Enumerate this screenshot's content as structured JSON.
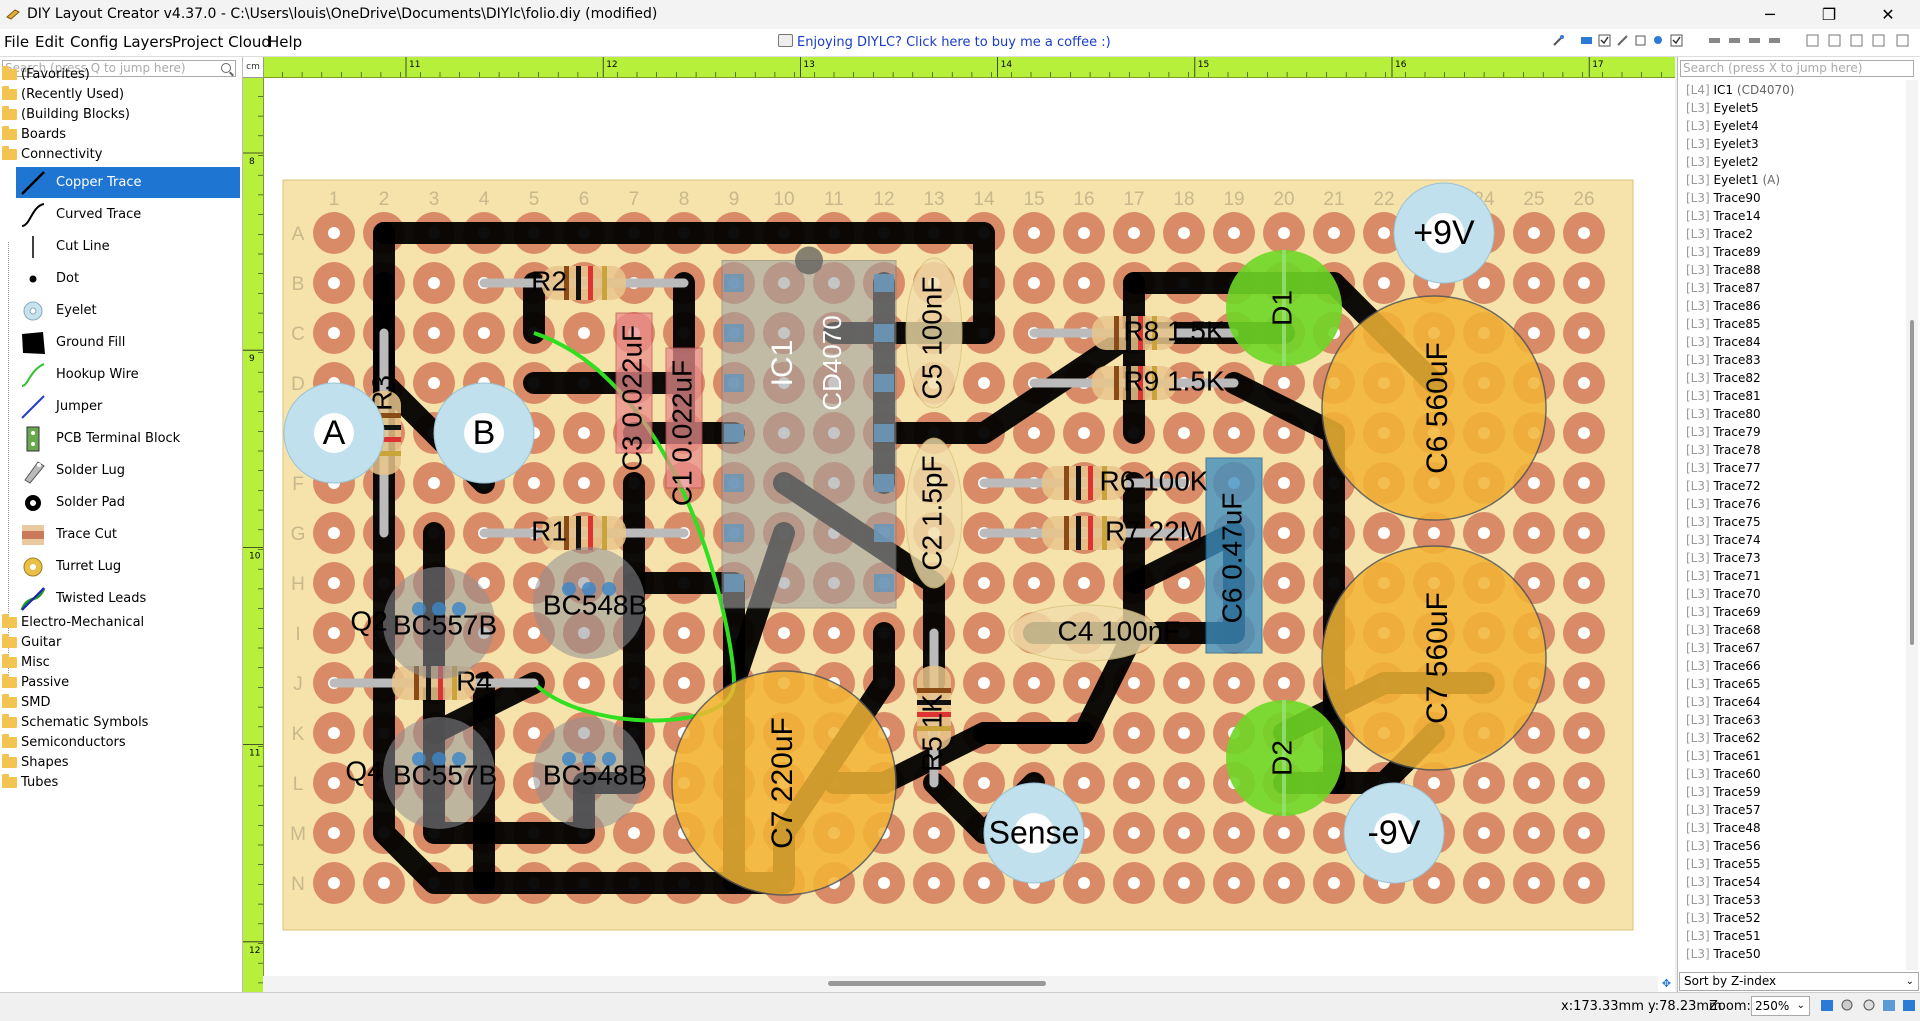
{
  "window": {
    "title": "DIY Layout Creator v4.37.0 - C:\\Users\\louis\\OneDrive\\Documents\\DIYlc\\folio.diy  (modified)",
    "controls": {
      "minimize": "─",
      "restore": "❐",
      "close": "✕"
    }
  },
  "menu": {
    "items": [
      "File",
      "Edit",
      "Config",
      "Layers",
      "Project Cloud",
      "Help"
    ],
    "coffee_link": "Enjoying DIYLC? Click here to buy me a coffee :)"
  },
  "left_panel": {
    "search_placeholder": "Search (press Q to jump here)",
    "folders_top": [
      "(Favorites)",
      "(Recently Used)",
      "(Building Blocks)",
      "Boards",
      "Connectivity"
    ],
    "connectivity_items": [
      {
        "label": "Copper Trace",
        "icon": "copper-trace-icon",
        "selected": true
      },
      {
        "label": "Curved Trace",
        "icon": "curved-trace-icon"
      },
      {
        "label": "Cut Line",
        "icon": "cut-line-icon"
      },
      {
        "label": "Dot",
        "icon": "dot-icon"
      },
      {
        "label": "Eyelet",
        "icon": "eyelet-icon"
      },
      {
        "label": "Ground Fill",
        "icon": "ground-fill-icon"
      },
      {
        "label": "Hookup Wire",
        "icon": "hookup-wire-icon"
      },
      {
        "label": "Jumper",
        "icon": "jumper-icon"
      },
      {
        "label": "PCB Terminal Block",
        "icon": "pcb-terminal-block-icon"
      },
      {
        "label": "Solder Lug",
        "icon": "solder-lug-icon"
      },
      {
        "label": "Solder Pad",
        "icon": "solder-pad-icon"
      },
      {
        "label": "Trace Cut",
        "icon": "trace-cut-icon"
      },
      {
        "label": "Turret Lug",
        "icon": "turret-lug-icon"
      },
      {
        "label": "Twisted Leads",
        "icon": "twisted-leads-icon"
      }
    ],
    "folders_bottom": [
      "Electro-Mechanical",
      "Guitar",
      "Misc",
      "Passive",
      "SMD",
      "Schematic Symbols",
      "Semiconductors",
      "Shapes",
      "Tubes"
    ]
  },
  "canvas": {
    "ruler_unit": "cm",
    "ruler_top": [
      "11",
      "12",
      "13",
      "14",
      "15",
      "16",
      "17"
    ],
    "ruler_left": [
      "8",
      "9",
      "10",
      "11",
      "12"
    ],
    "board": {
      "column_labels": [
        "1",
        "2",
        "3",
        "4",
        "5",
        "6",
        "7",
        "8",
        "9",
        "10",
        "11",
        "12",
        "13",
        "14",
        "15",
        "16",
        "17",
        "18",
        "19",
        "20",
        "21",
        "22",
        "23",
        "24",
        "25",
        "26"
      ],
      "row_labels": [
        "A",
        "B",
        "C",
        "D",
        "E",
        "F",
        "G",
        "H",
        "I",
        "J",
        "K",
        "L",
        "M",
        "N"
      ]
    },
    "labels": {
      "eyelet_a": "A",
      "eyelet_b": "B",
      "plus9v": "+9V",
      "minus9v": "-9V",
      "sense": "Sense",
      "r2": "R2",
      "r3": "R3",
      "r1": "R1",
      "r4": "R4",
      "r5": "R5 1K",
      "r6": "R6 100K",
      "r7": "R7 22M",
      "r8": "R8 1.5K",
      "r9": "R9 1.5K",
      "c3": "C3 0.022uF",
      "c1": "C1 0.022uF",
      "ic1": "IC1",
      "ic1_part": "CD4070",
      "c5": "C5 100nF",
      "c2": "C2 1.5pF",
      "c4": "C4 100nF",
      "c6a": "C6 0.47uF",
      "c6b": "C6 560uF",
      "c7a": "C7 560uF",
      "c7b": "C7 220uF",
      "d1": "D1",
      "d2": "D2",
      "q2": "Q2",
      "q2_part": "BC557B",
      "q1_part": "BC548B",
      "q4": "Q4",
      "q4_part": "BC557B",
      "q3_part": "BC548B"
    }
  },
  "right_panel": {
    "search_placeholder": "Search (press X to jump here)",
    "items": [
      {
        "layer": "[L4]",
        "name": "IC1",
        "note": "(CD4070)"
      },
      {
        "layer": "[L3]",
        "name": "Eyelet5"
      },
      {
        "layer": "[L3]",
        "name": "Eyelet4"
      },
      {
        "layer": "[L3]",
        "name": "Eyelet3"
      },
      {
        "layer": "[L3]",
        "name": "Eyelet2"
      },
      {
        "layer": "[L3]",
        "name": "Eyelet1",
        "note": "(A)"
      },
      {
        "layer": "[L3]",
        "name": "Trace90"
      },
      {
        "layer": "[L3]",
        "name": "Trace14"
      },
      {
        "layer": "[L3]",
        "name": "Trace2"
      },
      {
        "layer": "[L3]",
        "name": "Trace89"
      },
      {
        "layer": "[L3]",
        "name": "Trace88"
      },
      {
        "layer": "[L3]",
        "name": "Trace87"
      },
      {
        "layer": "[L3]",
        "name": "Trace86"
      },
      {
        "layer": "[L3]",
        "name": "Trace85"
      },
      {
        "layer": "[L3]",
        "name": "Trace84"
      },
      {
        "layer": "[L3]",
        "name": "Trace83"
      },
      {
        "layer": "[L3]",
        "name": "Trace82"
      },
      {
        "layer": "[L3]",
        "name": "Trace81"
      },
      {
        "layer": "[L3]",
        "name": "Trace80"
      },
      {
        "layer": "[L3]",
        "name": "Trace79"
      },
      {
        "layer": "[L3]",
        "name": "Trace78"
      },
      {
        "layer": "[L3]",
        "name": "Trace77"
      },
      {
        "layer": "[L3]",
        "name": "Trace72"
      },
      {
        "layer": "[L3]",
        "name": "Trace76"
      },
      {
        "layer": "[L3]",
        "name": "Trace75"
      },
      {
        "layer": "[L3]",
        "name": "Trace74"
      },
      {
        "layer": "[L3]",
        "name": "Trace73"
      },
      {
        "layer": "[L3]",
        "name": "Trace71"
      },
      {
        "layer": "[L3]",
        "name": "Trace70"
      },
      {
        "layer": "[L3]",
        "name": "Trace69"
      },
      {
        "layer": "[L3]",
        "name": "Trace68"
      },
      {
        "layer": "[L3]",
        "name": "Trace67"
      },
      {
        "layer": "[L3]",
        "name": "Trace66"
      },
      {
        "layer": "[L3]",
        "name": "Trace65"
      },
      {
        "layer": "[L3]",
        "name": "Trace64"
      },
      {
        "layer": "[L3]",
        "name": "Trace63"
      },
      {
        "layer": "[L3]",
        "name": "Trace62"
      },
      {
        "layer": "[L3]",
        "name": "Trace61"
      },
      {
        "layer": "[L3]",
        "name": "Trace60"
      },
      {
        "layer": "[L3]",
        "name": "Trace59"
      },
      {
        "layer": "[L3]",
        "name": "Trace57"
      },
      {
        "layer": "[L3]",
        "name": "Trace48"
      },
      {
        "layer": "[L3]",
        "name": "Trace56"
      },
      {
        "layer": "[L3]",
        "name": "Trace55"
      },
      {
        "layer": "[L3]",
        "name": "Trace54"
      },
      {
        "layer": "[L3]",
        "name": "Trace53"
      },
      {
        "layer": "[L3]",
        "name": "Trace52"
      },
      {
        "layer": "[L3]",
        "name": "Trace51"
      },
      {
        "layer": "[L3]",
        "name": "Trace50"
      }
    ],
    "sort_label": "Sort by Z-index"
  },
  "status": {
    "coords": "x:173.33mm y:78.23mm",
    "zoom_label": "Zoom:",
    "zoom_value": "250%"
  },
  "colors": {
    "ruler": "#b6f03a",
    "board": "#f5e3ab",
    "pad": "#d98a66",
    "trace": "#000000",
    "selection": "#1e76d2",
    "eyelet": "#bfe0ec",
    "electrolytic": "#f3b535",
    "diode": "#6fd626",
    "hookup_wire": "#30e020"
  }
}
